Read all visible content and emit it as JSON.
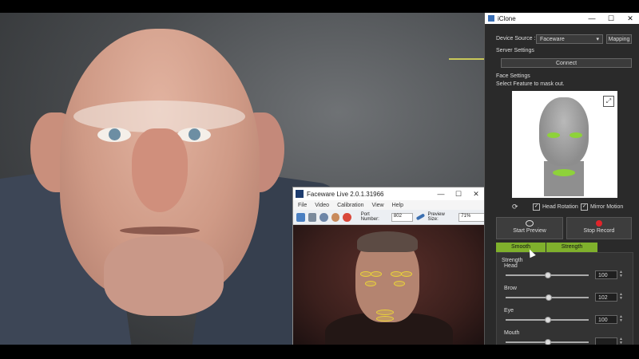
{
  "faceware": {
    "title": "Faceware Live 2.0.1.31966",
    "menu": [
      "File",
      "Video",
      "Calibration",
      "View",
      "Help"
    ],
    "port_label": "Port Number:",
    "port_value": "802",
    "preview_size_label": "Preview Size:",
    "preview_size_value": "71%",
    "window_buttons": [
      "—",
      "☐",
      "✕"
    ]
  },
  "iclone": {
    "title": "iClone",
    "window_buttons": [
      "—",
      "☐",
      "✕"
    ],
    "device_source_label": "Device Source :",
    "device_source_value": "Faceware",
    "mapping_button": "Mapping",
    "server_settings_label": "Server Settings",
    "connect_button": "Connect",
    "face_settings_label": "Face Settings",
    "mask_hint": "Select Feature to mask out.",
    "head_rotation_label": "Head Rotation",
    "mirror_motion_label": "Mirror Motion",
    "start_preview_button": "Start Preview",
    "stop_record_button": "Stop Record",
    "tabs": [
      "Smooth",
      "Strength"
    ],
    "strength_title": "Strength",
    "sliders": [
      {
        "label": "Head",
        "value": "100",
        "level": 0.5
      },
      {
        "label": "Brow",
        "value": "102",
        "level": 0.51
      },
      {
        "label": "Eye",
        "value": "100",
        "level": 0.5
      },
      {
        "label": "Mouth",
        "value": "",
        "level": 0.5
      }
    ],
    "accent": "#7fb02c",
    "record_color": "#e0242a"
  }
}
